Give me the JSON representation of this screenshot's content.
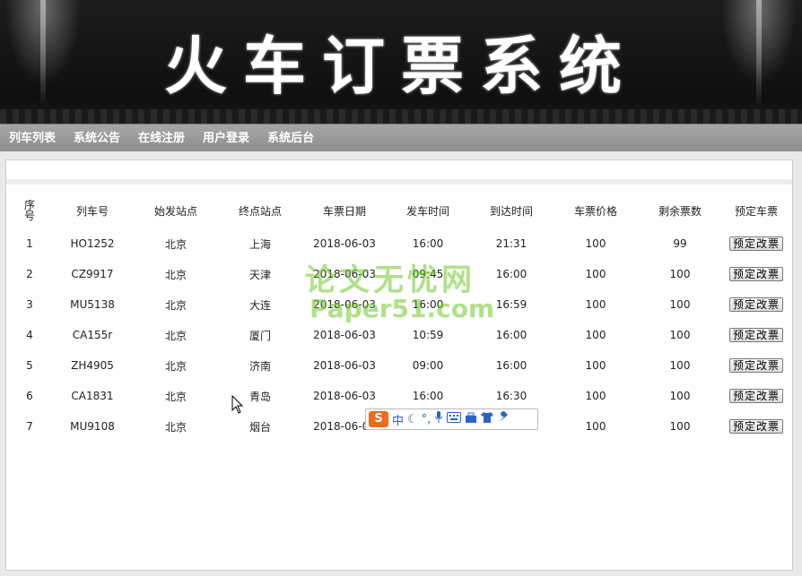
{
  "banner": {
    "title": "火车订票系统"
  },
  "nav": {
    "items": [
      "列车列表",
      "系统公告",
      "在线注册",
      "用户登录",
      "系统后台"
    ]
  },
  "table": {
    "headers": {
      "index": "序号",
      "train_no": "列车号",
      "from": "始发站点",
      "to": "终点站点",
      "date": "车票日期",
      "depart": "发车时间",
      "arrive": "到达时间",
      "price": "车票价格",
      "remaining": "剩余票数",
      "action": "预定车票"
    },
    "rows": [
      {
        "index": "1",
        "train_no": "HO1252",
        "from": "北京",
        "to": "上海",
        "date": "2018-06-03",
        "depart": "16:00",
        "arrive": "21:31",
        "price": "100",
        "remaining": "99"
      },
      {
        "index": "2",
        "train_no": "CZ9917",
        "from": "北京",
        "to": "天津",
        "date": "2018-06-03",
        "depart": "09:45",
        "arrive": "16:00",
        "price": "100",
        "remaining": "100"
      },
      {
        "index": "3",
        "train_no": "MU5138",
        "from": "北京",
        "to": "大连",
        "date": "2018-06-03",
        "depart": "16:00",
        "arrive": "16:59",
        "price": "100",
        "remaining": "100"
      },
      {
        "index": "4",
        "train_no": "CA155r",
        "from": "北京",
        "to": "厦门",
        "date": "2018-06-03",
        "depart": "10:59",
        "arrive": "16:00",
        "price": "100",
        "remaining": "100"
      },
      {
        "index": "5",
        "train_no": "ZH4905",
        "from": "北京",
        "to": "济南",
        "date": "2018-06-03",
        "depart": "09:00",
        "arrive": "16:00",
        "price": "100",
        "remaining": "100"
      },
      {
        "index": "6",
        "train_no": "CA1831",
        "from": "北京",
        "to": "青岛",
        "date": "2018-06-03",
        "depart": "16:00",
        "arrive": "16:30",
        "price": "100",
        "remaining": "100"
      },
      {
        "index": "7",
        "train_no": "MU9108",
        "from": "北京",
        "to": "烟台",
        "date": "2018-06-03",
        "depart": "",
        "arrive": "",
        "price": "100",
        "remaining": "100"
      }
    ],
    "button_label": "预定改票"
  },
  "watermark": {
    "line1": "论文无忧网",
    "line2": "Paper51.com"
  },
  "ime": {
    "logo": "S",
    "mode": "中",
    "icons": [
      "moon-icon",
      "punctuation-icon",
      "microphone-icon",
      "keyboard-icon",
      "toolbox-icon",
      "shirt-icon",
      "wrench-icon"
    ]
  },
  "colors": {
    "banner_bg": "#111111",
    "nav_bg": "#9a9a9a",
    "watermark": "#6ec828",
    "ime_logo": "#f26a1b"
  }
}
